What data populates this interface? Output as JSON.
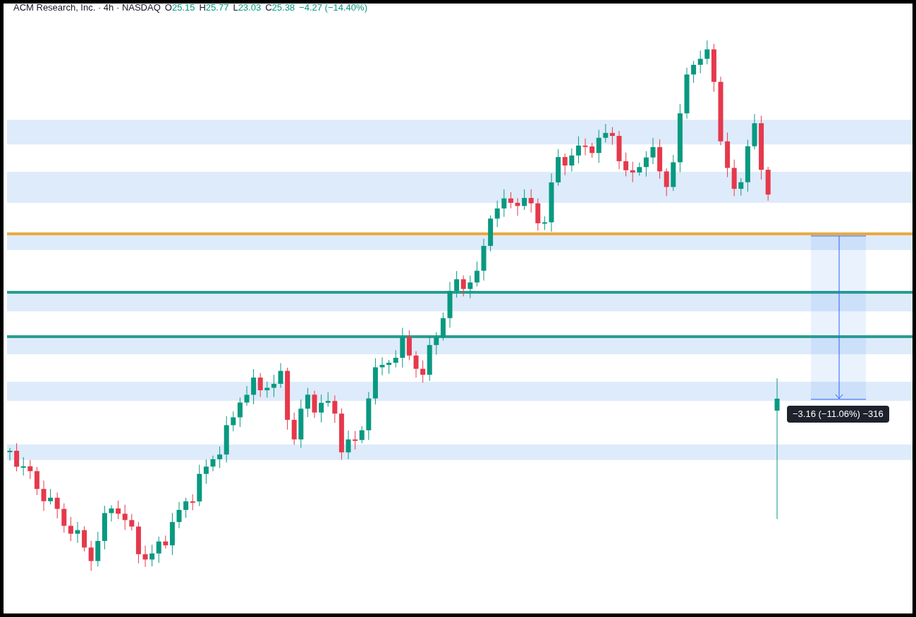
{
  "legend": {
    "title": "ACM Research, Inc. · 4h · NASDAQ",
    "ohlc": [
      {
        "label": "O",
        "value": "25.15"
      },
      {
        "label": "H",
        "value": "25.77"
      },
      {
        "label": "L",
        "value": "23.03"
      },
      {
        "label": "C",
        "value": "25.38"
      }
    ],
    "change": "−4.27 (−14.40%)"
  },
  "measure": {
    "label": "−3.16 (−11.06%) −316"
  }
}
